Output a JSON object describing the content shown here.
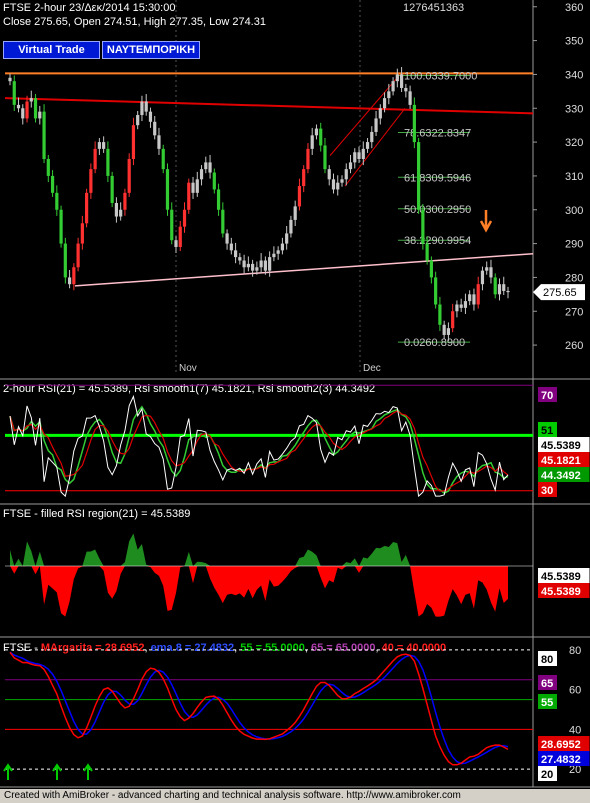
{
  "header": {
    "line1": "FTSE  2-hour  23/Δεκ/2014 15:30:00",
    "line2": "Close 275.65, Open 274.51, High 277.35, Low 274.31",
    "corner_code": "1276451363"
  },
  "buttons": {
    "virtual_trade": "Virtual Trade",
    "temporary": "ΝΑΥΤΕΜΠΟΡΙΚΗ"
  },
  "footer_text": "Created with AmiBroker - advanced charting and technical analysis software. http://www.amibroker.com",
  "colors": {
    "background": "#000000",
    "bull": "#c8c8c8",
    "bear_up": "#ff3030",
    "bear_down": "#33cc33",
    "channel": "#e00000",
    "resistance": "#ff7f27",
    "support": "#ffc0cb",
    "rsi_line": "#ffffff",
    "rsi_smooth1": "#e00000",
    "rsi_smooth2": "#33cc33",
    "filled_above": "#1e8c1e",
    "filled_below": "#ff0000",
    "margarita": "#ff0000",
    "ema": "#0000ff",
    "level_55": "#00aa00",
    "level_65": "#800080",
    "level_40": "#ff0000",
    "marker_arrow": "#ff7f27"
  },
  "chart_data": [
    {
      "type": "candlestick",
      "title": "FTSE 2-hour",
      "x_labels": [
        "Nov",
        "Dec"
      ],
      "ylim": [
        255,
        362
      ],
      "y_ticks": [
        260,
        270,
        280,
        290,
        300,
        310,
        320,
        330,
        340,
        350,
        360
      ],
      "last_price_label": "275.65",
      "fib_levels": [
        {
          "label": "100.0",
          "value": 339.7,
          "text": "100.0339.7000"
        },
        {
          "label": "78.6",
          "value": 322.8347,
          "text": "78.6322.8347"
        },
        {
          "label": "61.8",
          "value": 309.5946,
          "text": "61.8309.5946"
        },
        {
          "label": "50.0",
          "value": 300.295,
          "text": "50.0300.2950"
        },
        {
          "label": "38.2",
          "value": 290.9954,
          "text": "38.2290.9954"
        },
        {
          "label": "0.0",
          "value": 260.89,
          "text": "0.0260.8900"
        }
      ],
      "series": [
        {
          "name": "price",
          "close": [
            338,
            331,
            330,
            327,
            332,
            333,
            327,
            329,
            315,
            310,
            305,
            300,
            290,
            280,
            278,
            283,
            290,
            296,
            305,
            312,
            318,
            320,
            318,
            310,
            302,
            298,
            300,
            305,
            315,
            325,
            328,
            332,
            329,
            326,
            322,
            318,
            312,
            300,
            291,
            289,
            295,
            300,
            308,
            305,
            309,
            312,
            314,
            311,
            306,
            300,
            293,
            290,
            288,
            286,
            285,
            283,
            284,
            282,
            283,
            285,
            282,
            286,
            287,
            288,
            290,
            293,
            297,
            301,
            307,
            312,
            318,
            322,
            324,
            319,
            312,
            309,
            306,
            308,
            309,
            312,
            314,
            317,
            315,
            318,
            320,
            323,
            327,
            330,
            333,
            335,
            338,
            340,
            336,
            335,
            331,
            320,
            300,
            290,
            285,
            280,
            272,
            266,
            263,
            265,
            270,
            272,
            271,
            273,
            275,
            272,
            278,
            282,
            283,
            280,
            275,
            278,
            276,
            275.65
          ]
        }
      ]
    },
    {
      "type": "line",
      "title": "2-hour RSI(21) = 45.5389, Rsi smooth1(7) 45.1821, Rsi smooth2(3) 44.3492",
      "ylim": [
        25,
        72
      ],
      "levels": [
        30,
        51,
        70
      ],
      "right_labels": [
        "70",
        "51",
        "45.5389",
        "45.1821",
        "44.3492",
        "30"
      ],
      "series": [
        {
          "name": "RSI(21)",
          "last": 45.5389
        },
        {
          "name": "Rsi smooth1(7)",
          "last": 45.1821
        },
        {
          "name": "Rsi smooth2(3)",
          "last": 44.3492
        }
      ]
    },
    {
      "type": "area",
      "title": "FTSE - filled RSI region(21) = 45.5389",
      "baseline": 51,
      "right_labels": [
        "45.5389",
        "45.5389"
      ]
    },
    {
      "type": "line",
      "title": "FTSE - MArgarita = 28.6952, ema 8 = 27.4832, 55 = 55.0000, 65 = 65.0000, 40 = 40.0000",
      "title_parts": {
        "prefix": "FTSE - ",
        "margarita": "MArgarita = 28.6952",
        "ema": "ema 8 = 27.4832",
        "l55": "55 = 55.0000",
        "l65": "65 = 65.0000",
        "l40": "40 = 40.0000"
      },
      "ylim": [
        12,
        86
      ],
      "y_ticks": [
        20,
        40,
        60,
        80
      ],
      "levels": [
        20,
        40,
        55,
        65,
        80
      ],
      "right_labels": [
        "80",
        "65",
        "55",
        "28.6952",
        "27.4832",
        "20"
      ],
      "series": [
        {
          "name": "MArgarita",
          "last": 28.6952
        },
        {
          "name": "ema 8",
          "last": 27.4832
        }
      ]
    }
  ]
}
